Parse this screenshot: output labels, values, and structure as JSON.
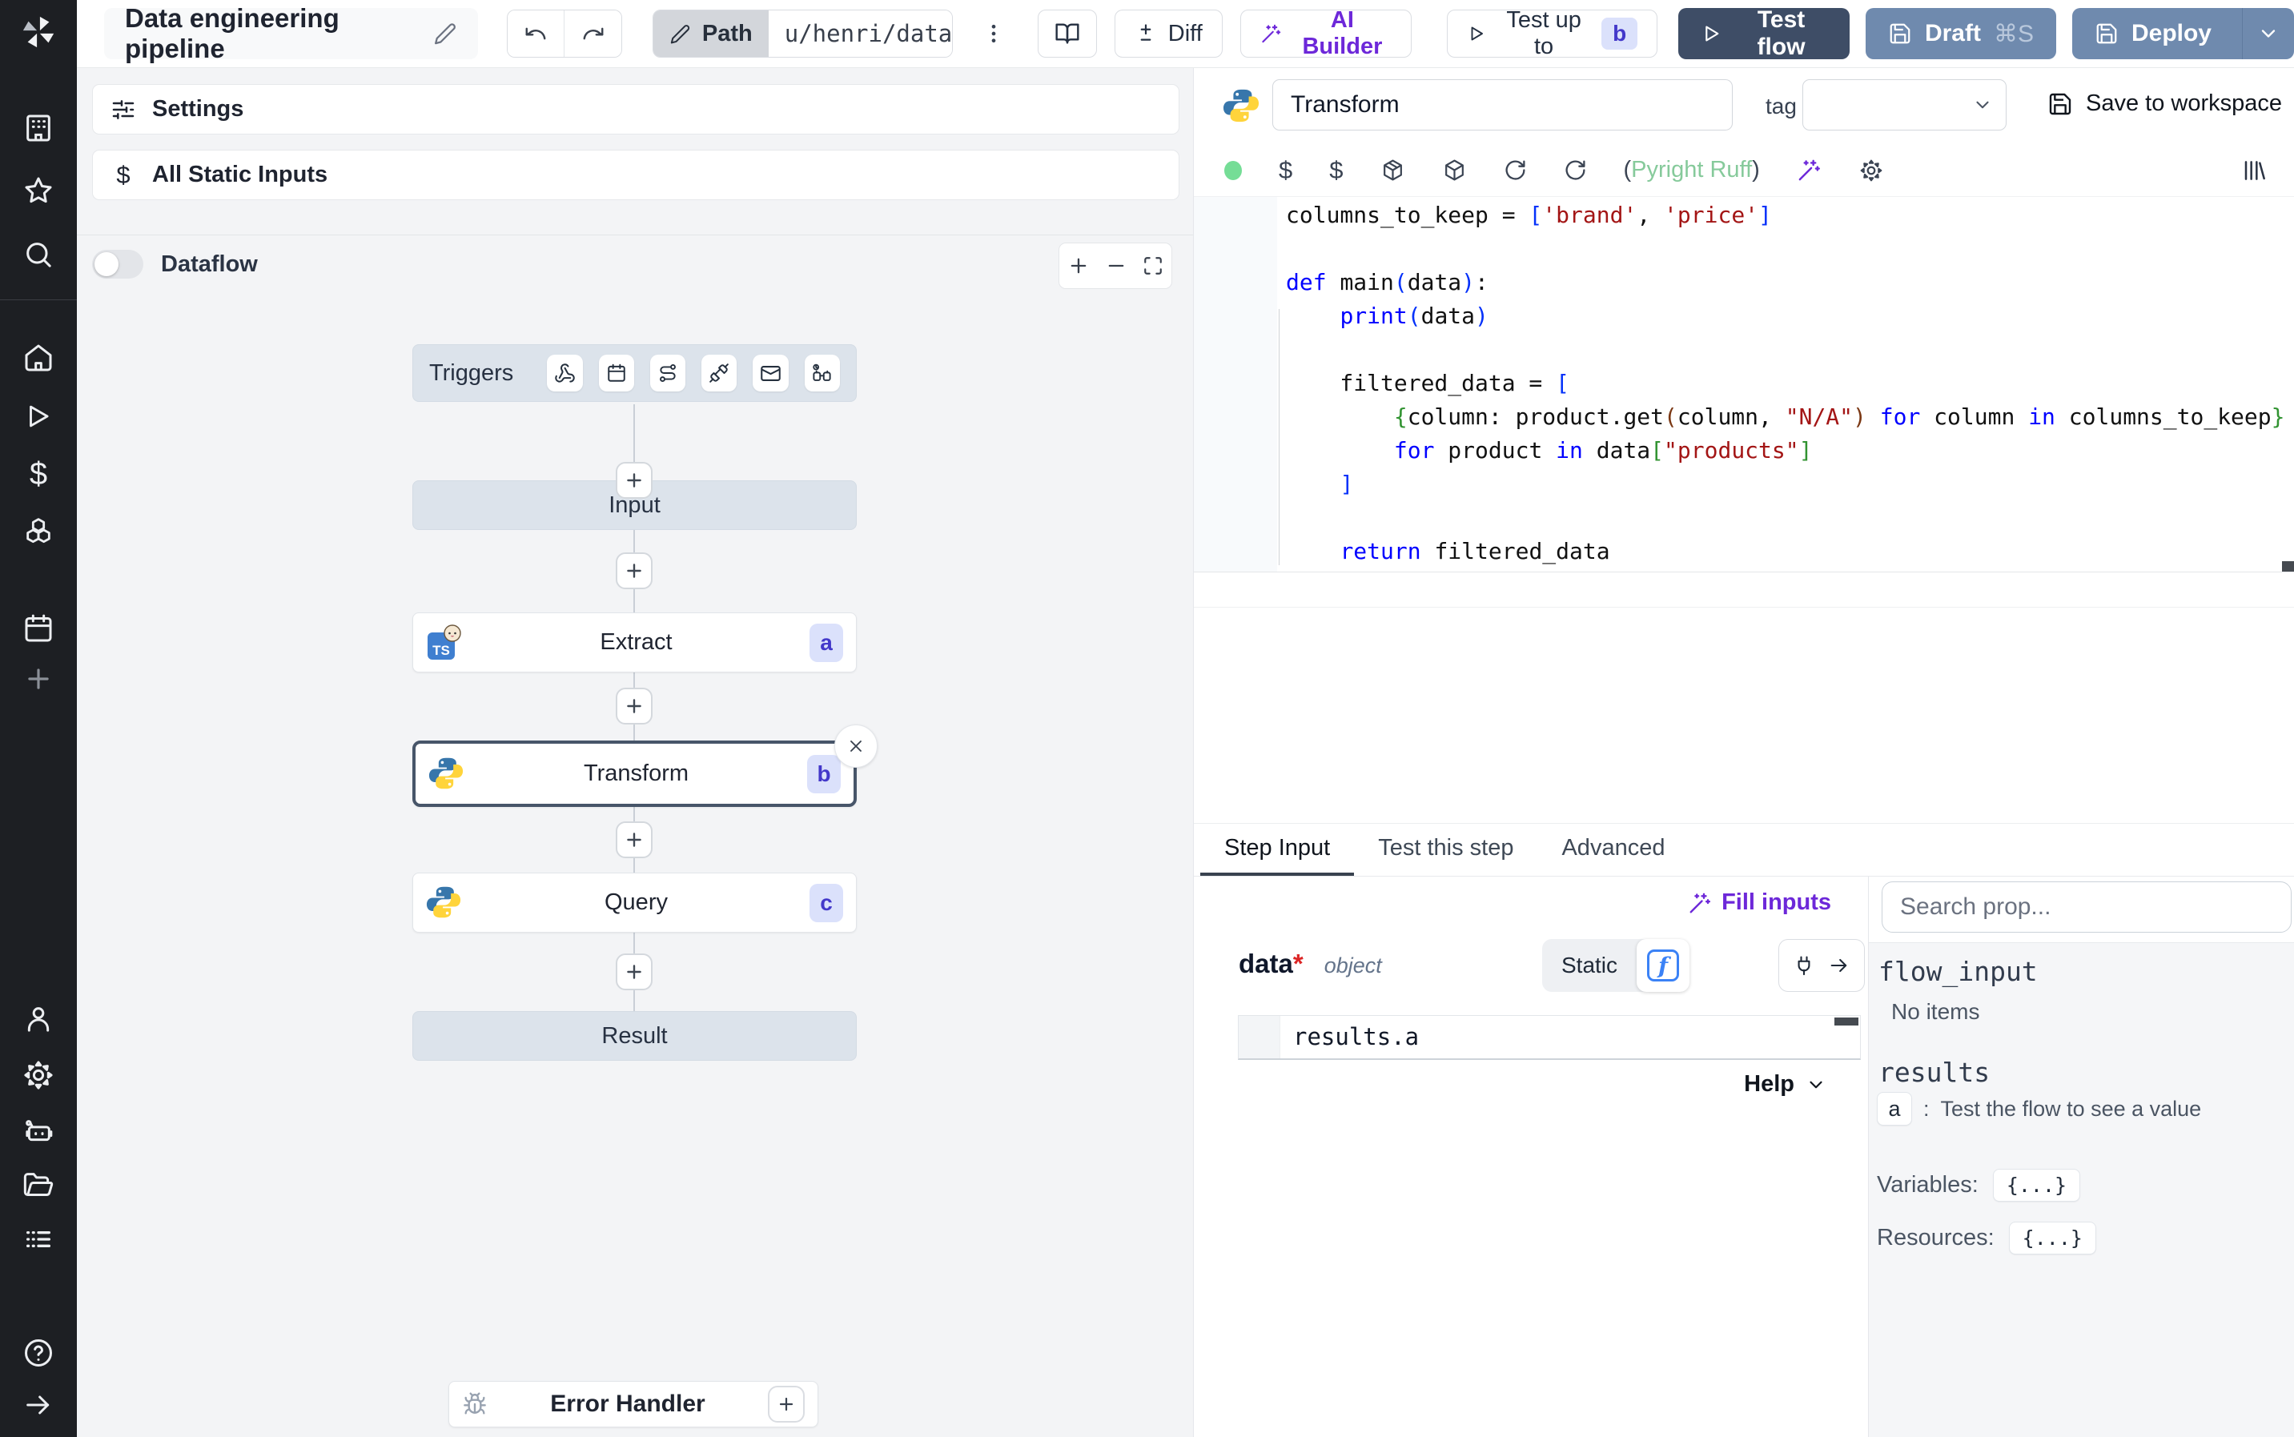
{
  "topbar": {
    "title": "Data engineering pipeline",
    "path_button": {
      "label": "Path",
      "value": "u/henri/data_"
    },
    "diff_button": "Diff",
    "ai_builder_button": "AI Builder",
    "test_up_to_button": {
      "label": "Test up to",
      "badge": "b"
    },
    "test_flow_button": "Test flow",
    "draft_button": {
      "label": "Draft",
      "shortcut": "⌘S"
    },
    "deploy_button": "Deploy"
  },
  "sidebar": {
    "icons": [
      "windmill-logo",
      "apps",
      "favorites",
      "search",
      "home",
      "runs",
      "variables",
      "resources",
      "schedules",
      "add",
      "user",
      "settings",
      "workers",
      "folders",
      "logs",
      "help",
      "expand"
    ]
  },
  "flow_panel": {
    "settings_label": "Settings",
    "all_static_inputs_label": "All Static Inputs",
    "dataflow_label": "Dataflow",
    "trigger_bar": {
      "label": "Triggers",
      "icons": [
        "webhook",
        "schedule",
        "route",
        "plug",
        "email",
        "poll"
      ]
    },
    "nodes": {
      "input": {
        "label": "Input"
      },
      "extract": {
        "label": "Extract",
        "badge": "a",
        "language": "bun-typescript"
      },
      "transform": {
        "label": "Transform",
        "badge": "b",
        "language": "python",
        "selected": true
      },
      "query": {
        "label": "Query",
        "badge": "c",
        "language": "python"
      },
      "result": {
        "label": "Result"
      },
      "error_handler": {
        "label": "Error Handler"
      }
    }
  },
  "editor": {
    "step_name": "Transform",
    "tag_label": "tag",
    "save_to_workspace_label": "Save to workspace",
    "lint_status": {
      "open": "(",
      "label": "Pyright Ruff",
      "close": ")"
    },
    "code": [
      [
        {
          "t": "columns_to_keep = ",
          "c": "d"
        },
        {
          "t": "[",
          "c": "b1"
        },
        {
          "t": "'brand'",
          "c": "s"
        },
        {
          "t": ", ",
          "c": "d"
        },
        {
          "t": "'price'",
          "c": "s"
        },
        {
          "t": "]",
          "c": "b1"
        }
      ],
      [],
      [
        {
          "t": "def ",
          "c": "k"
        },
        {
          "t": "main",
          "c": "d"
        },
        {
          "t": "(",
          "c": "b1"
        },
        {
          "t": "data",
          "c": "d"
        },
        {
          "t": ")",
          "c": "b1"
        },
        {
          "t": ":",
          "c": "d"
        }
      ],
      [
        {
          "t": "    ",
          "c": "d"
        },
        {
          "t": "print",
          "c": "k"
        },
        {
          "t": "(",
          "c": "b1"
        },
        {
          "t": "data",
          "c": "d"
        },
        {
          "t": ")",
          "c": "b1"
        }
      ],
      [],
      [
        {
          "t": "    filtered_data = ",
          "c": "d"
        },
        {
          "t": "[",
          "c": "b1"
        }
      ],
      [
        {
          "t": "        ",
          "c": "d"
        },
        {
          "t": "{",
          "c": "b2"
        },
        {
          "t": "column: product.get",
          "c": "d"
        },
        {
          "t": "(",
          "c": "b3"
        },
        {
          "t": "column, ",
          "c": "d"
        },
        {
          "t": "\"N/A\"",
          "c": "s"
        },
        {
          "t": ")",
          "c": "b3"
        },
        {
          "t": " ",
          "c": "d"
        },
        {
          "t": "for",
          "c": "k"
        },
        {
          "t": " column ",
          "c": "d"
        },
        {
          "t": "in",
          "c": "k"
        },
        {
          "t": " columns_to_keep",
          "c": "d"
        },
        {
          "t": "}",
          "c": "b2"
        }
      ],
      [
        {
          "t": "        ",
          "c": "d"
        },
        {
          "t": "for",
          "c": "k"
        },
        {
          "t": " product ",
          "c": "d"
        },
        {
          "t": "in",
          "c": "k"
        },
        {
          "t": " data",
          "c": "d"
        },
        {
          "t": "[",
          "c": "b2"
        },
        {
          "t": "\"products\"",
          "c": "s"
        },
        {
          "t": "]",
          "c": "b2"
        }
      ],
      [
        {
          "t": "    ",
          "c": "d"
        },
        {
          "t": "]",
          "c": "b1"
        }
      ],
      [],
      [
        {
          "t": "    ",
          "c": "d"
        },
        {
          "t": "return",
          "c": "k"
        },
        {
          "t": " filtered_data",
          "c": "d"
        }
      ]
    ]
  },
  "step_panel": {
    "tabs": [
      "Step Input",
      "Test this step",
      "Advanced"
    ],
    "active_tab": "Step Input",
    "fill_inputs_label": "Fill inputs",
    "arg": {
      "name": "data",
      "required_mark": "*",
      "type": "object"
    },
    "static_toggle_label": "Static",
    "expression_value": "results.a",
    "help_label": "Help"
  },
  "props_panel": {
    "search_placeholder": "Search prop...",
    "flow_input": {
      "label": "flow_input",
      "empty": "No items"
    },
    "results": {
      "label": "results",
      "item_badge": "a",
      "item_sep": ":",
      "item_hint": "Test the flow to see a value"
    },
    "variables": {
      "label": "Variables:",
      "value": "{...}"
    },
    "resources": {
      "label": "Resources:",
      "value": "{...}"
    }
  },
  "colors": {
    "accent_purple": "#6d28d9",
    "badge_bg": "#dbe1fb",
    "badge_text": "#4338ca",
    "test_flow_bg": "#3e4d66",
    "deploy_bg": "#6f8aae",
    "lint_green": "#86ca9b",
    "status_dot": "#75dd96",
    "node_bg": "#dce3eb",
    "selected_border": "#475569",
    "code_keyword": "#0000ff",
    "code_string": "#a31515",
    "code_bracket1": "#0431fa",
    "code_bracket2": "#319331",
    "code_bracket3": "#7b3814"
  }
}
